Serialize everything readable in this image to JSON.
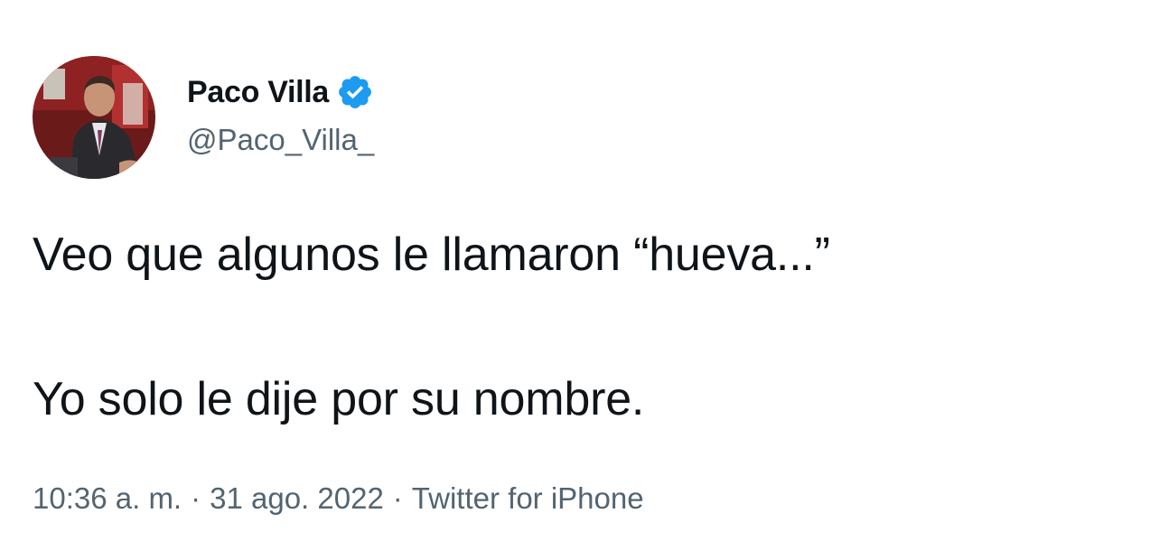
{
  "author": {
    "display_name": "Paco Villa",
    "handle": "@Paco_Villa_",
    "verified": true,
    "avatar_icon": "profile-photo"
  },
  "tweet": {
    "lines": [
      "Veo que algunos le llamaron “hueva...”",
      "Yo solo le dije por su nombre."
    ]
  },
  "meta": {
    "time": "10:36 a. m.",
    "separator": "·",
    "date": "31 ago. 2022",
    "source": "Twitter for iPhone"
  },
  "colors": {
    "text_primary": "#0f1419",
    "text_secondary": "#536471",
    "verified_blue": "#1d9bf0"
  }
}
